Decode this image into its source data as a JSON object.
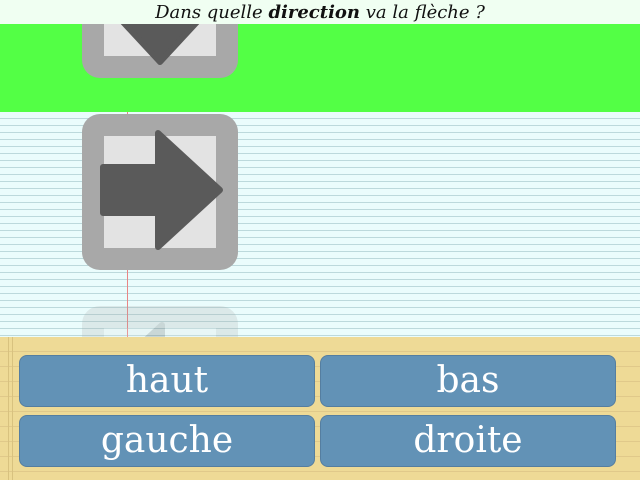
{
  "question": {
    "before": "Dans quelle ",
    "keyword": "direction",
    "after": " va la flèche ?"
  },
  "arrows": {
    "previous": "down",
    "current": "right",
    "next": "left"
  },
  "answers": {
    "up": "haut",
    "down": "bas",
    "left": "gauche",
    "right": "droite"
  },
  "colors": {
    "green_band": "#53ff45",
    "tile": "#a8a8a8",
    "arrow": "#5a5a5a",
    "button": "#6292b6"
  }
}
